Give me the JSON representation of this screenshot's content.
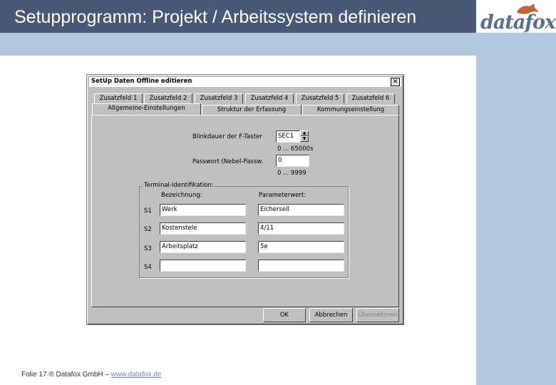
{
  "slide": {
    "title": "Setupprogramm: Projekt / Arbeitssystem definieren",
    "logo": "datafox",
    "footer_text": "Folie 17 ® Datafox GmbH – ",
    "footer_link": "www.datafox.de"
  },
  "dialog": {
    "title": "SetUp Daten Offline editieren",
    "close_glyph": "✕",
    "tabs_row1": [
      "Zusatzfeld 1",
      "Zusatzfeld 2",
      "Zusatzfeld 3",
      "Zusatzfeld 4",
      "Zusatzfeld 5",
      "Zusatzfeld 6"
    ],
    "tabs_row2": [
      "Allgemeine-Einstellungen",
      "Struktur der Erfassung",
      "Kommungseinstellung"
    ],
    "active_tab": "Allgemeine-Einstellungen",
    "blink": {
      "label": "Blinkdauer der F-Taster",
      "value": "SEC1",
      "range": "0 ... 65000s"
    },
    "password": {
      "label": "Passwort (Nebel-Passw.",
      "value": "0",
      "range": "0 ... 9999"
    },
    "group": {
      "legend": "Terminal-Identifikation:",
      "col_bezeichnung": "Bezeichnung:",
      "col_parameter": "Parameterwert:",
      "rows": [
        {
          "key": "S1",
          "bezeichnung": "Werk",
          "parameter": "Eichersell"
        },
        {
          "key": "S2",
          "bezeichnung": "Kostenstele",
          "parameter": "4/11"
        },
        {
          "key": "S3",
          "bezeichnung": "Arbeitsplatz",
          "parameter": "5e"
        },
        {
          "key": "S4",
          "bezeichnung": "",
          "parameter": ""
        }
      ]
    },
    "buttons": {
      "ok": "OK",
      "cancel": "Abbrechen",
      "apply": "Übernehmen"
    }
  },
  "colors": {
    "title_bar": "#4a5877",
    "accent_band": "#b3c8dc",
    "dialog_face": "#c0c0c0"
  }
}
